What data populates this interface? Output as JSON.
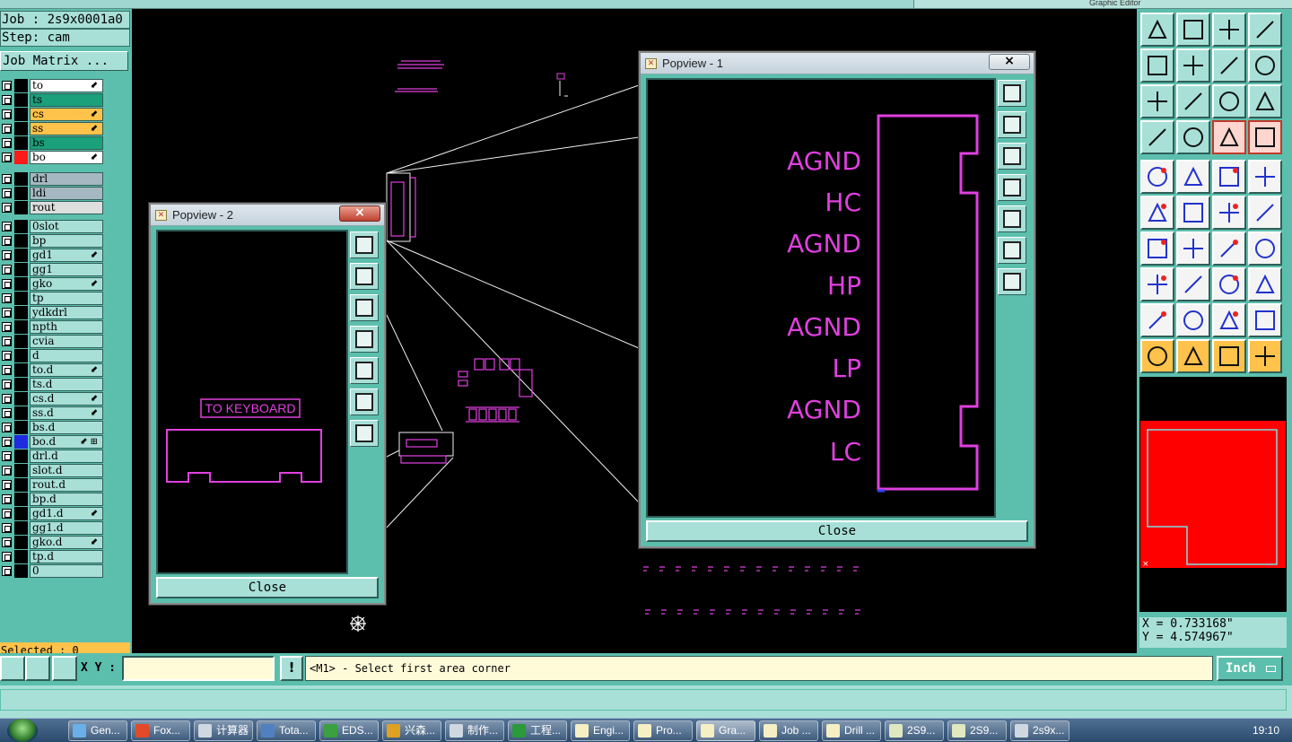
{
  "window": {
    "top_right_title": "Graphic Editor"
  },
  "left": {
    "job_label": "Job : 2s9x0001a0",
    "step_label": "Step: cam",
    "job_matrix_button": "Job Matrix ...",
    "layers": [
      {
        "name": "to",
        "style": "white",
        "mark": "⬋"
      },
      {
        "name": "ts",
        "style": "green",
        "mark": ""
      },
      {
        "name": "cs",
        "style": "orange",
        "mark": "⬋"
      },
      {
        "name": "ss",
        "style": "orange",
        "mark": "⬋"
      },
      {
        "name": "bs",
        "style": "green",
        "mark": ""
      },
      {
        "name": "bo",
        "style": "white",
        "mark": "⬋",
        "swatch": "#ff1a1a"
      },
      {
        "name": "drl",
        "style": "grey",
        "mark": ""
      },
      {
        "name": "ldi",
        "style": "grey",
        "mark": ""
      },
      {
        "name": "rout",
        "style": "lightgrey",
        "mark": ""
      },
      {
        "name": "0slot",
        "style": "teal",
        "mark": ""
      },
      {
        "name": "bp",
        "style": "teal",
        "mark": ""
      },
      {
        "name": "gd1",
        "style": "teal",
        "mark": "⬋"
      },
      {
        "name": "gg1",
        "style": "teal",
        "mark": ""
      },
      {
        "name": "gko",
        "style": "teal",
        "mark": "⬋"
      },
      {
        "name": "tp",
        "style": "teal",
        "mark": ""
      },
      {
        "name": "ydkdrl",
        "style": "teal",
        "mark": ""
      },
      {
        "name": "npth",
        "style": "teal",
        "mark": ""
      },
      {
        "name": "cvia",
        "style": "teal",
        "mark": ""
      },
      {
        "name": "d",
        "style": "teal",
        "mark": ""
      },
      {
        "name": "to.d",
        "style": "teal",
        "mark": "⬋"
      },
      {
        "name": "ts.d",
        "style": "teal",
        "mark": ""
      },
      {
        "name": "cs.d",
        "style": "teal",
        "mark": "⬋"
      },
      {
        "name": "ss.d",
        "style": "teal",
        "mark": "⬋"
      },
      {
        "name": "bs.d",
        "style": "teal",
        "mark": ""
      },
      {
        "name": "bo.d",
        "style": "teal",
        "mark": "⬋ ⊞",
        "swatch": "#1f2be0"
      },
      {
        "name": "drl.d",
        "style": "teal",
        "mark": ""
      },
      {
        "name": "slot.d",
        "style": "teal",
        "mark": ""
      },
      {
        "name": "rout.d",
        "style": "teal",
        "mark": ""
      },
      {
        "name": "bp.d",
        "style": "teal",
        "mark": ""
      },
      {
        "name": "gd1.d",
        "style": "teal",
        "mark": "⬋"
      },
      {
        "name": "gg1.d",
        "style": "teal",
        "mark": ""
      },
      {
        "name": "gko.d",
        "style": "teal",
        "mark": "⬋"
      },
      {
        "name": "tp.d",
        "style": "teal",
        "mark": ""
      },
      {
        "name": "0",
        "style": "teal",
        "mark": ""
      }
    ],
    "selected_label": "Selected : 0"
  },
  "popview1": {
    "title": "Popview - 1",
    "close_x": "×",
    "close_button": "Close",
    "labels": [
      "AGND",
      "HC",
      "AGND",
      "HP",
      "AGND",
      "LP",
      "AGND",
      "LC"
    ]
  },
  "popview2": {
    "title": "Popview - 2",
    "close_x": "×",
    "close_button": "Close",
    "board_text": "TO KEYBOARD"
  },
  "right": {
    "coord_x": "X = 0.733168\"",
    "coord_y": "Y = 4.574967\""
  },
  "command": {
    "xy_label": "X Y :",
    "xy_value": "",
    "excl_label": "!",
    "prompt": "<M1> - Select first area corner",
    "units": "Inch"
  },
  "taskbar": {
    "items": [
      "Gen...",
      "Fox...",
      "计算器",
      "Tota...",
      "EDS...",
      "兴森...",
      "制作...",
      "工程...",
      "Engi...",
      "Pro...",
      "Gra...",
      "Job ...",
      "Drill ...",
      "2S9...",
      "2S9...",
      "2s9x..."
    ],
    "clock": "19:10"
  },
  "colors": {
    "panel": "#5cbfad",
    "panel_light": "#a8e0d8",
    "magenta": "#e040e0",
    "highlight": "#ffc24a",
    "preview_red": "#ff0000"
  }
}
